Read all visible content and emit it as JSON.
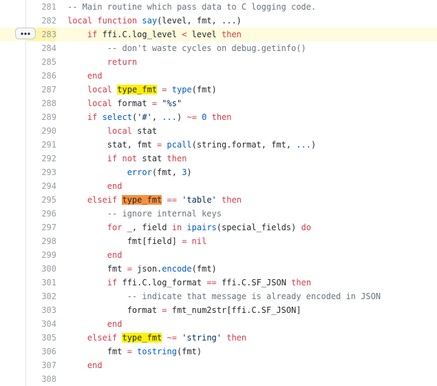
{
  "colors": {
    "keyword": "#d73a49",
    "function": "#005cc5",
    "comment": "#6a737d",
    "string": "#032f62",
    "identifier": "#24292e",
    "match_highlight": "#fff000",
    "active_match_highlight": "#f7913d",
    "highlighted_line_background": "#fffbdd"
  },
  "icons": {
    "line_actions": "kebab-horizontal-icon"
  },
  "highlighted_line": "283",
  "lines": [
    {
      "num": "281",
      "tokens": [
        {
          "t": "-- Main routine which pass data to C logging code.",
          "k": "cm"
        }
      ]
    },
    {
      "num": "282",
      "tokens": [
        {
          "t": "local ",
          "k": "kw"
        },
        {
          "t": "function ",
          "k": "kw"
        },
        {
          "t": "say",
          "k": "fn"
        },
        {
          "t": "(level, fmt, ...)",
          "k": "id"
        }
      ]
    },
    {
      "num": "283",
      "tokens": [
        {
          "t": "    ",
          "k": "id"
        },
        {
          "t": "if ",
          "k": "kw"
        },
        {
          "t": "ffi.C.log_level ",
          "k": "id"
        },
        {
          "t": "< ",
          "k": "op"
        },
        {
          "t": "level ",
          "k": "id"
        },
        {
          "t": "then",
          "k": "kw"
        }
      ]
    },
    {
      "num": "284",
      "tokens": [
        {
          "t": "        ",
          "k": "id"
        },
        {
          "t": "-- don't waste cycles on debug.getinfo()",
          "k": "cm"
        }
      ]
    },
    {
      "num": "285",
      "tokens": [
        {
          "t": "        ",
          "k": "id"
        },
        {
          "t": "return",
          "k": "kw"
        }
      ]
    },
    {
      "num": "286",
      "tokens": [
        {
          "t": "    ",
          "k": "id"
        },
        {
          "t": "end",
          "k": "kw"
        }
      ]
    },
    {
      "num": "287",
      "tokens": [
        {
          "t": "    ",
          "k": "id"
        },
        {
          "t": "local ",
          "k": "kw"
        },
        {
          "t": "type_fmt",
          "k": "mk"
        },
        {
          "t": " ",
          "k": "id"
        },
        {
          "t": "= ",
          "k": "op"
        },
        {
          "t": "type",
          "k": "fn"
        },
        {
          "t": "(fmt)",
          "k": "id"
        }
      ]
    },
    {
      "num": "288",
      "tokens": [
        {
          "t": "    ",
          "k": "id"
        },
        {
          "t": "local ",
          "k": "kw"
        },
        {
          "t": "format ",
          "k": "id"
        },
        {
          "t": "= ",
          "k": "op"
        },
        {
          "t": "\"%s\"",
          "k": "st"
        }
      ]
    },
    {
      "num": "289",
      "tokens": [
        {
          "t": "    ",
          "k": "id"
        },
        {
          "t": "if ",
          "k": "kw"
        },
        {
          "t": "select",
          "k": "fn"
        },
        {
          "t": "(",
          "k": "id"
        },
        {
          "t": "'#'",
          "k": "st"
        },
        {
          "t": ", ",
          "k": "id"
        },
        {
          "t": "...",
          "k": "nm"
        },
        {
          "t": ") ",
          "k": "id"
        },
        {
          "t": "~= ",
          "k": "op"
        },
        {
          "t": "0 ",
          "k": "nm"
        },
        {
          "t": "then",
          "k": "kw"
        }
      ]
    },
    {
      "num": "290",
      "tokens": [
        {
          "t": "        ",
          "k": "id"
        },
        {
          "t": "local ",
          "k": "kw"
        },
        {
          "t": "stat",
          "k": "id"
        }
      ]
    },
    {
      "num": "291",
      "tokens": [
        {
          "t": "        ",
          "k": "id"
        },
        {
          "t": "stat, fmt ",
          "k": "id"
        },
        {
          "t": "= ",
          "k": "op"
        },
        {
          "t": "pcall",
          "k": "fn"
        },
        {
          "t": "(string.format, fmt, ",
          "k": "id"
        },
        {
          "t": "...",
          "k": "nm"
        },
        {
          "t": ")",
          "k": "id"
        }
      ]
    },
    {
      "num": "292",
      "tokens": [
        {
          "t": "        ",
          "k": "id"
        },
        {
          "t": "if ",
          "k": "kw"
        },
        {
          "t": "not ",
          "k": "kw"
        },
        {
          "t": "stat ",
          "k": "id"
        },
        {
          "t": "then",
          "k": "kw"
        }
      ]
    },
    {
      "num": "293",
      "tokens": [
        {
          "t": "            ",
          "k": "id"
        },
        {
          "t": "error",
          "k": "fn"
        },
        {
          "t": "(fmt, ",
          "k": "id"
        },
        {
          "t": "3",
          "k": "nm"
        },
        {
          "t": ")",
          "k": "id"
        }
      ]
    },
    {
      "num": "294",
      "tokens": [
        {
          "t": "        ",
          "k": "id"
        },
        {
          "t": "end",
          "k": "kw"
        }
      ]
    },
    {
      "num": "295",
      "tokens": [
        {
          "t": "    ",
          "k": "id"
        },
        {
          "t": "elseif ",
          "k": "kw"
        },
        {
          "t": "type_fmt",
          "k": "mk-act"
        },
        {
          "t": " ",
          "k": "id"
        },
        {
          "t": "== ",
          "k": "op"
        },
        {
          "t": "'table'",
          "k": "st"
        },
        {
          "t": " ",
          "k": "id"
        },
        {
          "t": "then",
          "k": "kw"
        }
      ]
    },
    {
      "num": "296",
      "tokens": [
        {
          "t": "        ",
          "k": "id"
        },
        {
          "t": "-- ignore internal keys",
          "k": "cm"
        }
      ]
    },
    {
      "num": "297",
      "tokens": [
        {
          "t": "        ",
          "k": "id"
        },
        {
          "t": "for ",
          "k": "kw"
        },
        {
          "t": "_, field ",
          "k": "id"
        },
        {
          "t": "in ",
          "k": "kw"
        },
        {
          "t": "ipairs",
          "k": "fn"
        },
        {
          "t": "(special_fields) ",
          "k": "id"
        },
        {
          "t": "do",
          "k": "kw"
        }
      ]
    },
    {
      "num": "298",
      "tokens": [
        {
          "t": "            ",
          "k": "id"
        },
        {
          "t": "fmt[field] ",
          "k": "id"
        },
        {
          "t": "= ",
          "k": "op"
        },
        {
          "t": "nil",
          "k": "kw"
        }
      ]
    },
    {
      "num": "299",
      "tokens": [
        {
          "t": "        ",
          "k": "id"
        },
        {
          "t": "end",
          "k": "kw"
        }
      ]
    },
    {
      "num": "300",
      "tokens": [
        {
          "t": "        ",
          "k": "id"
        },
        {
          "t": "fmt ",
          "k": "id"
        },
        {
          "t": "= ",
          "k": "op"
        },
        {
          "t": "json.",
          "k": "id"
        },
        {
          "t": "encode",
          "k": "fn"
        },
        {
          "t": "(fmt)",
          "k": "id"
        }
      ]
    },
    {
      "num": "301",
      "tokens": [
        {
          "t": "        ",
          "k": "id"
        },
        {
          "t": "if ",
          "k": "kw"
        },
        {
          "t": "ffi.C.log_format ",
          "k": "id"
        },
        {
          "t": "== ",
          "k": "op"
        },
        {
          "t": "ffi.C.SF_JSON ",
          "k": "id"
        },
        {
          "t": "then",
          "k": "kw"
        }
      ]
    },
    {
      "num": "302",
      "tokens": [
        {
          "t": "            ",
          "k": "id"
        },
        {
          "t": "-- indicate that message is already encoded in JSON",
          "k": "cm"
        }
      ]
    },
    {
      "num": "303",
      "tokens": [
        {
          "t": "            ",
          "k": "id"
        },
        {
          "t": "format ",
          "k": "id"
        },
        {
          "t": "= ",
          "k": "op"
        },
        {
          "t": "fmt_num2str[ffi.C.SF_JSON]",
          "k": "id"
        }
      ]
    },
    {
      "num": "304",
      "tokens": [
        {
          "t": "        ",
          "k": "id"
        },
        {
          "t": "end",
          "k": "kw"
        }
      ]
    },
    {
      "num": "305",
      "tokens": [
        {
          "t": "    ",
          "k": "id"
        },
        {
          "t": "elseif ",
          "k": "kw"
        },
        {
          "t": "type_fmt",
          "k": "mk"
        },
        {
          "t": " ",
          "k": "id"
        },
        {
          "t": "~= ",
          "k": "op"
        },
        {
          "t": "'string'",
          "k": "st"
        },
        {
          "t": " ",
          "k": "id"
        },
        {
          "t": "then",
          "k": "kw"
        }
      ]
    },
    {
      "num": "306",
      "tokens": [
        {
          "t": "        ",
          "k": "id"
        },
        {
          "t": "fmt ",
          "k": "id"
        },
        {
          "t": "= ",
          "k": "op"
        },
        {
          "t": "tostring",
          "k": "fn"
        },
        {
          "t": "(fmt)",
          "k": "id"
        }
      ]
    },
    {
      "num": "307",
      "tokens": [
        {
          "t": "    ",
          "k": "id"
        },
        {
          "t": "end",
          "k": "kw"
        }
      ]
    },
    {
      "num": "308",
      "tokens": []
    }
  ]
}
